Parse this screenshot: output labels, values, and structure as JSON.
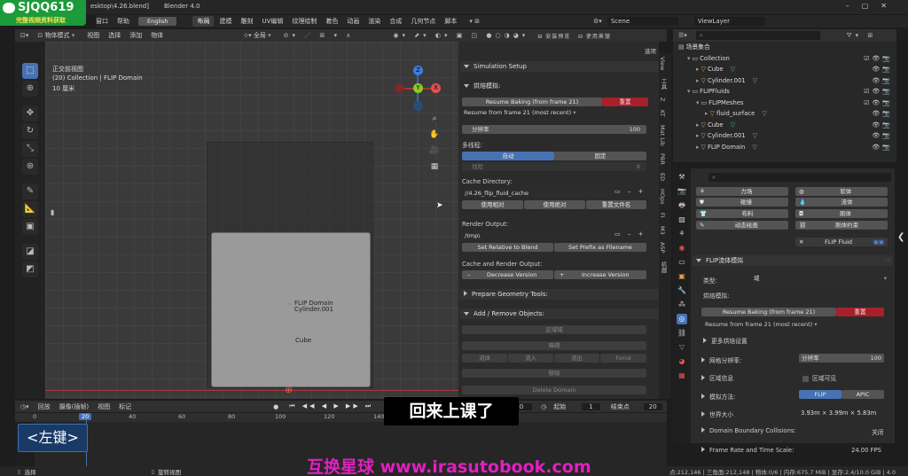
{
  "title_bar": {
    "path": "esktop\\4.26.blend]",
    "app": "Blender 4.0"
  },
  "watermark": {
    "logo_text": "SJQQ619",
    "sub_text": "完整视频资料获取"
  },
  "top_menu": {
    "items": [
      "窗口",
      "帮助"
    ],
    "language_button": "English",
    "workspaces": [
      "布局",
      "建模",
      "雕刻",
      "UV编辑",
      "纹理绘制",
      "着色",
      "动画",
      "渲染",
      "合成",
      "几何节点",
      "脚本"
    ],
    "scene_label": "Scene",
    "view_layer_label": "ViewLayer"
  },
  "viewport_header": {
    "mode": "物体模式",
    "menus": [
      "视图",
      "选择",
      "添加",
      "物体"
    ],
    "transform_orientation": "全局",
    "options_label": "选项"
  },
  "viewport": {
    "view_name": "正交前视图",
    "collection_info": "(20) Collection | FLIP Domain",
    "units": "10 厘米",
    "labels": [
      "FLIP Domain",
      "Cylinder.001",
      "Cube"
    ],
    "axis_labels": {
      "z": "Z",
      "y": "Y",
      "x": "X"
    }
  },
  "simulation_panel": {
    "header": "Simulation Setup",
    "bake_section": "烘焙模拟:",
    "resume_baking": "Resume Baking  (from frame 21)",
    "reset": "重置",
    "resume_dropdown": "Resume from frame 21 (most recent)",
    "resolution_label": "分辨率",
    "resolution_value": "100",
    "threading_label": "多线程:",
    "thread_auto": "自动",
    "thread_fixed": "固定",
    "threads_label": "线程",
    "threads_value": "8",
    "cache_dir_label": "Cache Directory:",
    "cache_dir_value": "//4.26_flip_fluid_cache",
    "use_relative": "使用相对",
    "use_absolute": "使用绝对",
    "rename_file": "重置文件名",
    "render_output_label": "Render Output:",
    "render_output_value": "/tmp\\",
    "set_relative": "Set Relative to Blend",
    "set_prefix": "Set Prefix as Filename",
    "cache_render_label": "Cache and Render Output:",
    "decrease_version": "Decrease Version",
    "increase_version": "Increase Version",
    "prepare_geometry": "Prepare Geometry Tools:",
    "add_remove": "Add / Remove Objects:",
    "domain_btn": "区域域",
    "obstacle_btn": "障碍",
    "fluid_btn": "流体",
    "inflow_btn": "流入",
    "outflow_btn": "流出",
    "force_btn": "Force",
    "remove_btn": "移除",
    "delete_domain": "Delete Domain"
  },
  "n_panel_tabs": [
    "View",
    "工具",
    "Z",
    "KT",
    "Mat Lib",
    "PBR",
    "ED",
    "HOps",
    "FI",
    "M3",
    "ASP",
    "机器"
  ],
  "outliner": {
    "scene_collection": "场景集合",
    "rows": [
      {
        "indent": 1,
        "name": "Collection",
        "type": "collection"
      },
      {
        "indent": 2,
        "name": "Cube",
        "type": "mesh"
      },
      {
        "indent": 2,
        "name": "Cylinder.001",
        "type": "mesh"
      },
      {
        "indent": 1,
        "name": "FLIPFluids",
        "type": "collection"
      },
      {
        "indent": 2,
        "name": "FLIPMeshes",
        "type": "collection"
      },
      {
        "indent": 3,
        "name": "fluid_surface",
        "type": "mesh"
      },
      {
        "indent": 2,
        "name": "Cube",
        "type": "mesh"
      },
      {
        "indent": 2,
        "name": "Cylinder.001",
        "type": "mesh"
      },
      {
        "indent": 2,
        "name": "FLIP Domain",
        "type": "mesh"
      }
    ]
  },
  "physics": {
    "left_buttons": [
      "力场",
      "碰撞",
      "布料",
      "动态绘画"
    ],
    "right_buttons": [
      "软体",
      "流体",
      "刚体",
      "刚体约束"
    ],
    "flip_fluid": "FLIP Fluid",
    "domain_header": "FLIP流体模拟",
    "type_label": "类型:",
    "type_value": "域",
    "bake_label": "烘焙模拟:",
    "resume_baking": "Resume Baking  (from frame 21)",
    "reset": "重置",
    "resume_dropdown": "Resume from frame 21 (most recent)",
    "more_bake": "更多烘焙设置",
    "grid_res_label": "网格分辨率:",
    "res_label": "分辨率",
    "res_value": "100",
    "domain_info": "区域信息",
    "domain_visible": "区域可见",
    "sim_method": "模拟方法:",
    "flip": "FLIP",
    "apic": "APIC",
    "world_size": "世界大小",
    "world_size_value": "3.93m  ×  3.99m  ×  5.83m",
    "boundary_collisions": "Domain Boundary Collisions:",
    "boundary_value": "关闭",
    "frame_rate": "Frame Rate and Time Scale:",
    "frame_rate_value": "24.00 FPS"
  },
  "timeline": {
    "menus": [
      "回放",
      "摄像(插帧)",
      "视图",
      "标记"
    ],
    "current_frame": "20",
    "start_label": "起始",
    "start_value": "1",
    "end_label": "结束点",
    "end_value": "20",
    "ruler": [
      "0",
      "20",
      "40",
      "60",
      "80",
      "100",
      "120",
      "140"
    ]
  },
  "status_bar": {
    "select": "选择",
    "rotate": "旋转视图",
    "stats": "点:212,146 | 三角面:212,148 | 物体:0/6 | 内存:675.7 MiB | 显存:2.4/10.0 GiB | 4.0"
  },
  "overlays": {
    "subtitle": "回来上课了",
    "key_hint": "<左键>",
    "website": "互换星球 www.irasutobook.com"
  }
}
